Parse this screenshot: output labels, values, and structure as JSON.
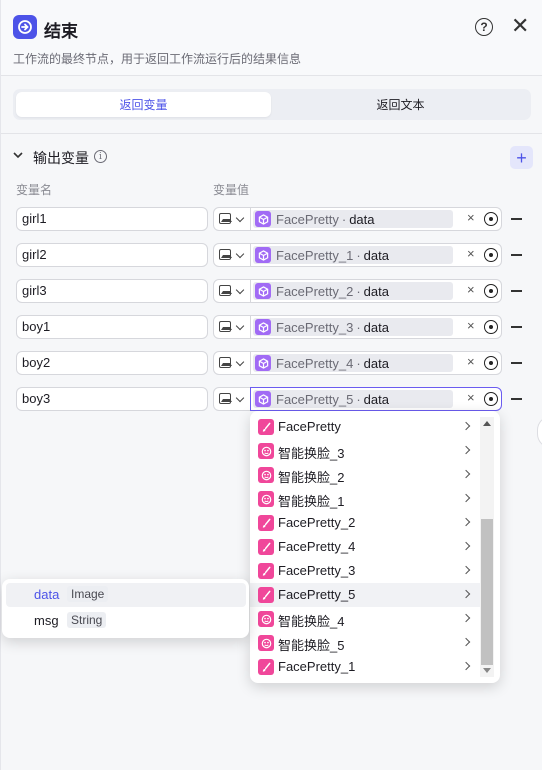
{
  "header": {
    "title": "结束",
    "subtitle": "工作流的最终节点，用于返回工作流运行后的结果信息",
    "help_label": "?",
    "close_label": "✕"
  },
  "tabs": [
    {
      "label": "返回变量",
      "active": true
    },
    {
      "label": "返回文本",
      "active": false
    }
  ],
  "section": {
    "title": "输出变量",
    "info_label": "i",
    "add_label": "+",
    "col_name": "变量名",
    "col_value": "变量值"
  },
  "rows": [
    {
      "name": "girl1",
      "node": "FacePretty",
      "sep": "·",
      "field": "data",
      "clear": "×"
    },
    {
      "name": "girl2",
      "node": "FacePretty_1",
      "sep": "·",
      "field": "data",
      "clear": "×"
    },
    {
      "name": "girl3",
      "node": "FacePretty_2",
      "sep": "·",
      "field": "data",
      "clear": "×"
    },
    {
      "name": "boy1",
      "node": "FacePretty_3",
      "sep": "·",
      "field": "data",
      "clear": "×"
    },
    {
      "name": "boy2",
      "node": "FacePretty_4",
      "sep": "·",
      "field": "data",
      "clear": "×"
    },
    {
      "name": "boy3",
      "node": "FacePretty_5",
      "sep": "·",
      "field": "data",
      "clear": "×"
    }
  ],
  "dropdown": {
    "items": [
      {
        "label": "FacePretty",
        "icon": "brush-icon"
      },
      {
        "label": "智能换脸_3",
        "icon": "face-icon"
      },
      {
        "label": "智能换脸_2",
        "icon": "face-icon"
      },
      {
        "label": "智能换脸_1",
        "icon": "face-icon"
      },
      {
        "label": "FacePretty_2",
        "icon": "brush-icon"
      },
      {
        "label": "FacePretty_4",
        "icon": "brush-icon"
      },
      {
        "label": "FacePretty_3",
        "icon": "brush-icon"
      },
      {
        "label": "FacePretty_5",
        "icon": "brush-icon",
        "highlighted": true
      },
      {
        "label": "智能换脸_4",
        "icon": "face-icon"
      },
      {
        "label": "智能换脸_5",
        "icon": "face-icon"
      },
      {
        "label": "FacePretty_1",
        "icon": "brush-icon"
      }
    ]
  },
  "subpanel": {
    "items": [
      {
        "name": "data",
        "type": "Image",
        "selected": true
      },
      {
        "name": "msg",
        "type": "String",
        "selected": false
      }
    ]
  },
  "colors": {
    "accent": "#4d53e8",
    "node_icon": "#a16bf5",
    "plugin_icon": "#f0479a"
  }
}
